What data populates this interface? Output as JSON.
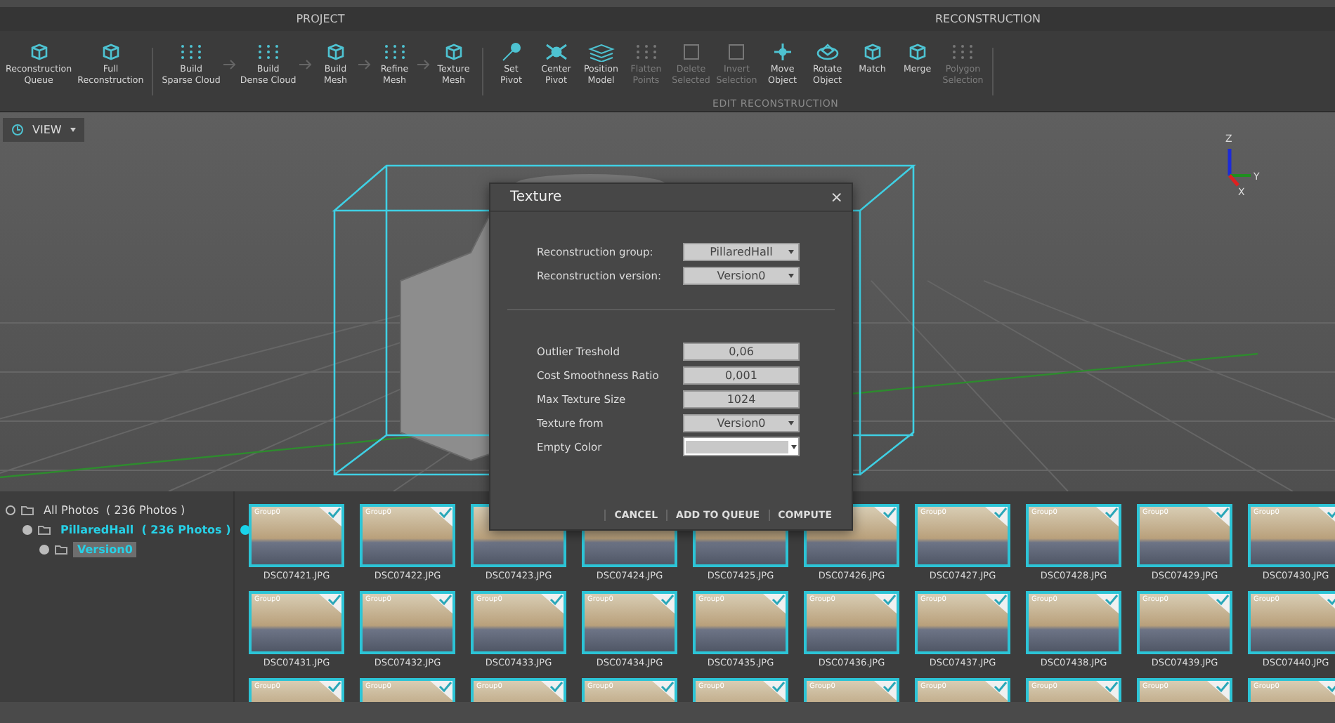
{
  "ribbon": {
    "sections": [
      {
        "title": "PROJECT"
      },
      {
        "title": "RECONSTRUCTION"
      }
    ],
    "tools": [
      {
        "kind": "tool",
        "label": "Reconstruction\nQueue",
        "disabled": false
      },
      {
        "kind": "tool",
        "label": "Full\nReconstruction",
        "disabled": false
      },
      {
        "kind": "separator"
      },
      {
        "kind": "tool",
        "label": "Build\nSparse Cloud",
        "disabled": false
      },
      {
        "kind": "arrow"
      },
      {
        "kind": "tool",
        "label": "Build\nDense Cloud",
        "disabled": false
      },
      {
        "kind": "arrow"
      },
      {
        "kind": "tool",
        "label": "Build\nMesh",
        "disabled": false
      },
      {
        "kind": "arrow"
      },
      {
        "kind": "tool",
        "label": "Refine\nMesh",
        "disabled": false
      },
      {
        "kind": "arrow"
      },
      {
        "kind": "tool",
        "label": "Texture\nMesh",
        "disabled": false
      },
      {
        "kind": "separator"
      },
      {
        "kind": "tool",
        "label": "Set\nPivot",
        "disabled": false
      },
      {
        "kind": "tool",
        "label": "Center\nPivot",
        "disabled": false
      },
      {
        "kind": "tool",
        "label": "Position\nModel",
        "disabled": false
      },
      {
        "kind": "tool",
        "label": "Flatten\nPoints",
        "disabled": true
      },
      {
        "kind": "tool",
        "label": "Delete\nSelected",
        "disabled": true
      },
      {
        "kind": "tool",
        "label": "Invert\nSelection",
        "disabled": true
      },
      {
        "kind": "tool",
        "label": "Move\nObject",
        "disabled": false
      },
      {
        "kind": "tool",
        "label": "Rotate\nObject",
        "disabled": false
      },
      {
        "kind": "tool",
        "label": "Match",
        "disabled": false
      },
      {
        "kind": "tool",
        "label": "Merge",
        "disabled": false
      },
      {
        "kind": "tool",
        "label": "Polygon\nSelection",
        "disabled": true
      },
      {
        "kind": "separator"
      }
    ],
    "edit_group_label": "EDIT RECONSTRUCTION"
  },
  "viewport": {
    "view_button": "VIEW",
    "axes": {
      "z": "Z",
      "y": "Y",
      "x": "X"
    }
  },
  "dialog": {
    "title": "Texture",
    "close": "×",
    "group_fields": [
      {
        "kind": "dropdown",
        "label": "Reconstruction group:",
        "value": "PillaredHall"
      },
      {
        "kind": "dropdown",
        "label": "Reconstruction version:",
        "value": "Version0"
      }
    ],
    "fields": [
      {
        "kind": "input",
        "label": "Outlier Treshold",
        "value": "0,06"
      },
      {
        "kind": "input",
        "label": "Cost Smoothness Ratio",
        "value": "0,001"
      },
      {
        "kind": "input",
        "label": "Max Texture Size",
        "value": "1024"
      },
      {
        "kind": "dropdown",
        "label": "Texture from",
        "value": "Version0"
      },
      {
        "kind": "color",
        "label": "Empty Color",
        "color": "#c8c8c8"
      }
    ],
    "buttons": [
      "CANCEL",
      "ADD TO QUEUE",
      "COMPUTE"
    ]
  },
  "tree": [
    {
      "label": "All Photos  ( 236 Photos )",
      "checked": false,
      "active": false,
      "selected": false,
      "children": [
        {
          "label": "PillaredHall  ( 236 Photos )",
          "checked": true,
          "active": true,
          "selected": false,
          "color": "#19d3ea",
          "children": [
            {
              "label": "Version0",
              "checked": true,
              "active": true,
              "selected": true
            }
          ]
        }
      ]
    }
  ],
  "photos": [
    {
      "name": "DSC07421.JPG",
      "group": "Group0",
      "checked": true
    },
    {
      "name": "DSC07422.JPG",
      "group": "Group0",
      "checked": true
    },
    {
      "name": "DSC07423.JPG"
    },
    {
      "name": "DSC07424.JPG"
    },
    {
      "name": "DSC07425.JPG"
    },
    {
      "name": "DSC07426.JPG",
      "checked": true
    },
    {
      "name": "DSC07427.JPG",
      "group": "Group0",
      "checked": true
    },
    {
      "name": "DSC07428.JPG",
      "group": "Group0",
      "checked": true
    },
    {
      "name": "DSC07429.JPG",
      "group": "Group0",
      "checked": true
    },
    {
      "name": "DSC07430.JPG",
      "group": "Group0",
      "checked": true
    },
    {
      "name": "DSC07431.JPG",
      "group": "Group0",
      "checked": true
    },
    {
      "name": "DSC07432.JPG",
      "group": "Group0",
      "checked": true
    },
    {
      "name": "DSC07433.JPG",
      "group": "Group0",
      "checked": true
    },
    {
      "name": "DSC07434.JPG",
      "group": "Group0",
      "checked": true
    },
    {
      "name": "DSC07435.JPG",
      "group": "Group0",
      "checked": true
    },
    {
      "name": "DSC07436.JPG",
      "group": "Group0",
      "checked": true
    },
    {
      "name": "DSC07437.JPG",
      "group": "Group0",
      "checked": true
    },
    {
      "name": "DSC07438.JPG",
      "group": "Group0",
      "checked": true
    },
    {
      "name": "DSC07439.JPG",
      "group": "Group0",
      "checked": true
    },
    {
      "name": "DSC07440.JPG",
      "group": "Group0",
      "checked": true
    },
    {
      "group": "Group0",
      "checked": true
    },
    {
      "group": "Group0",
      "checked": true
    },
    {
      "group": "Group0",
      "checked": true
    },
    {
      "group": "Group0",
      "checked": true
    },
    {
      "group": "Group0",
      "checked": true
    },
    {
      "group": "Group0",
      "checked": true
    },
    {
      "group": "Group0",
      "checked": true
    },
    {
      "group": "Group0",
      "checked": true
    },
    {
      "group": "Group0",
      "checked": true
    },
    {
      "group": "Group0",
      "checked": true
    }
  ]
}
